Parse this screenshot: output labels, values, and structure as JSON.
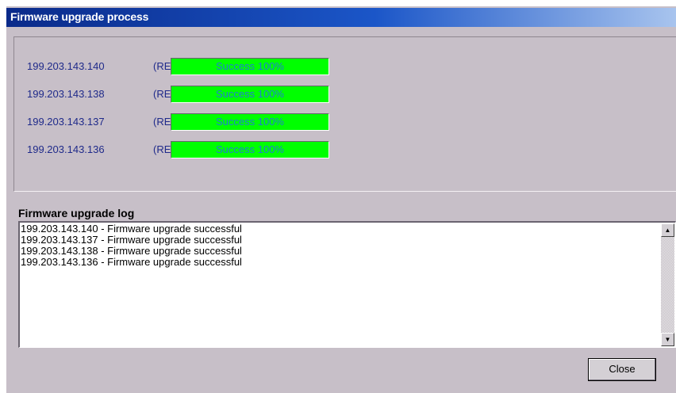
{
  "window": {
    "title": "Firmware upgrade process"
  },
  "devices": [
    {
      "ip": "199.203.143.140",
      "prefix": "(RE",
      "status": "Success 100%",
      "progress": 1.0
    },
    {
      "ip": "199.203.143.138",
      "prefix": "(RE",
      "status": "Success 100%",
      "progress": 1.0
    },
    {
      "ip": "199.203.143.137",
      "prefix": "(RE",
      "status": "Success 100%",
      "progress": 1.0
    },
    {
      "ip": "199.203.143.136",
      "prefix": "(RE",
      "status": "Success 100%",
      "progress": 1.0
    }
  ],
  "log": {
    "heading": "Firmware upgrade log",
    "lines": [
      "199.203.143.140 - Firmware upgrade successful",
      "199.203.143.137 - Firmware upgrade successful",
      "199.203.143.138 - Firmware upgrade successful",
      "199.203.143.136 - Firmware upgrade successful"
    ]
  },
  "buttons": {
    "close_label": "Close"
  },
  "icons": {
    "scroll_up": "scroll-up-arrow-icon",
    "scroll_down": "scroll-down-arrow-icon"
  },
  "colors": {
    "titlebar_start": "#0a2a8a",
    "titlebar_end": "#a8c4ee",
    "progress_fill": "#00ff00",
    "progress_text": "#1f7fd0",
    "ip_text": "#1f2a8a",
    "dialog_bg": "#c7bfc8"
  }
}
